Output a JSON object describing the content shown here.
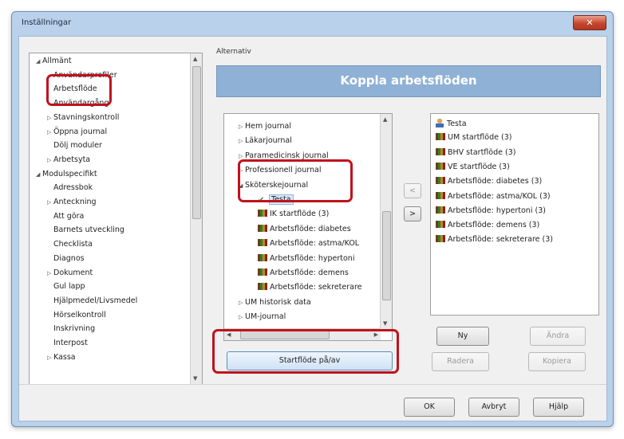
{
  "window": {
    "title": "Inställningar",
    "close_label": "✕"
  },
  "left_tree": {
    "items": [
      {
        "label": "Allmänt",
        "arrow": "◢",
        "indent": 0
      },
      {
        "label": "Användarprofiler",
        "arrow": "",
        "indent": 1
      },
      {
        "label": "Arbetsflöde",
        "arrow": "",
        "indent": 1
      },
      {
        "label": "Användargång",
        "arrow": "",
        "indent": 1
      },
      {
        "label": "Stavningskontroll",
        "arrow": "▷",
        "indent": 1
      },
      {
        "label": "Öppna journal",
        "arrow": "▷",
        "indent": 1
      },
      {
        "label": "Dölj moduler",
        "arrow": "",
        "indent": 1
      },
      {
        "label": "Arbetsyta",
        "arrow": "▷",
        "indent": 1
      },
      {
        "label": "Modulspecifikt",
        "arrow": "◢",
        "indent": 0
      },
      {
        "label": "Adressbok",
        "arrow": "",
        "indent": 1
      },
      {
        "label": "Anteckning",
        "arrow": "▷",
        "indent": 1
      },
      {
        "label": "Att göra",
        "arrow": "",
        "indent": 1
      },
      {
        "label": "Barnets utveckling",
        "arrow": "",
        "indent": 1
      },
      {
        "label": "Checklista",
        "arrow": "",
        "indent": 1
      },
      {
        "label": "Diagnos",
        "arrow": "",
        "indent": 1
      },
      {
        "label": "Dokument",
        "arrow": "▷",
        "indent": 1
      },
      {
        "label": "Gul lapp",
        "arrow": "",
        "indent": 1
      },
      {
        "label": "Hjälpmedel/Livsmedel",
        "arrow": "",
        "indent": 1
      },
      {
        "label": "Hörselkontroll",
        "arrow": "",
        "indent": 1
      },
      {
        "label": "Inskrivning",
        "arrow": "",
        "indent": 1
      },
      {
        "label": "Interpost",
        "arrow": "",
        "indent": 1
      },
      {
        "label": "Kassa",
        "arrow": "▷",
        "indent": 1
      }
    ]
  },
  "options": {
    "label": "Alternativ",
    "header": "Koppla arbetsflöden"
  },
  "middle_tree": {
    "items": [
      {
        "label": "Hem journal",
        "arrow": "▷",
        "indent": 0,
        "icon": ""
      },
      {
        "label": "Läkarjournal",
        "arrow": "▷",
        "indent": 0,
        "icon": ""
      },
      {
        "label": "Paramedicinsk journal",
        "arrow": "▷",
        "indent": 0,
        "icon": ""
      },
      {
        "label": "Professionell journal",
        "arrow": "▷",
        "indent": 0,
        "icon": ""
      },
      {
        "label": "Sköterskejournal",
        "arrow": "◢",
        "indent": 0,
        "icon": ""
      },
      {
        "label": "Testa",
        "arrow": "",
        "indent": 1,
        "icon": "check"
      },
      {
        "label": "IK startflöde (3)",
        "arrow": "",
        "indent": 1,
        "icon": "wf"
      },
      {
        "label": "Arbetsflöde: diabetes",
        "arrow": "",
        "indent": 1,
        "icon": "wf"
      },
      {
        "label": "Arbetsflöde: astma/KOL",
        "arrow": "",
        "indent": 1,
        "icon": "wf"
      },
      {
        "label": "Arbetsflöde: hypertoni",
        "arrow": "",
        "indent": 1,
        "icon": "wf"
      },
      {
        "label": "Arbetsflöde: demens",
        "arrow": "",
        "indent": 1,
        "icon": "wf"
      },
      {
        "label": "Arbetsflöde: sekreterare",
        "arrow": "",
        "indent": 1,
        "icon": "wf"
      },
      {
        "label": "UM historisk data",
        "arrow": "▷",
        "indent": 0,
        "icon": ""
      },
      {
        "label": "UM-journal",
        "arrow": "▷",
        "indent": 0,
        "icon": ""
      }
    ]
  },
  "right_list": {
    "items": [
      {
        "label": "Testa",
        "icon": "person"
      },
      {
        "label": "UM startflöde (3)",
        "icon": "wf"
      },
      {
        "label": "BHV startflöde (3)",
        "icon": "wf"
      },
      {
        "label": "VE startflöde (3)",
        "icon": "wf"
      },
      {
        "label": "Arbetsflöde: diabetes (3)",
        "icon": "wf"
      },
      {
        "label": "Arbetsflöde: astma/KOL (3)",
        "icon": "wf"
      },
      {
        "label": "Arbetsflöde: hypertoni (3)",
        "icon": "wf"
      },
      {
        "label": "Arbetsflöde: demens (3)",
        "icon": "wf"
      },
      {
        "label": "Arbetsflöde: sekreterare (3)",
        "icon": "wf"
      }
    ]
  },
  "transfer": {
    "left_label": "<",
    "right_label": ">"
  },
  "buttons": {
    "startflode": "Startflöde på/av",
    "ny": "Ny",
    "andra": "Ändra",
    "radera": "Radera",
    "kopiera": "Kopiera",
    "ok": "OK",
    "avbryt": "Avbryt",
    "hjalp": "Hjälp"
  },
  "colors": {
    "header_bg": "#8fb1d6",
    "highlight": "#c0121d"
  }
}
